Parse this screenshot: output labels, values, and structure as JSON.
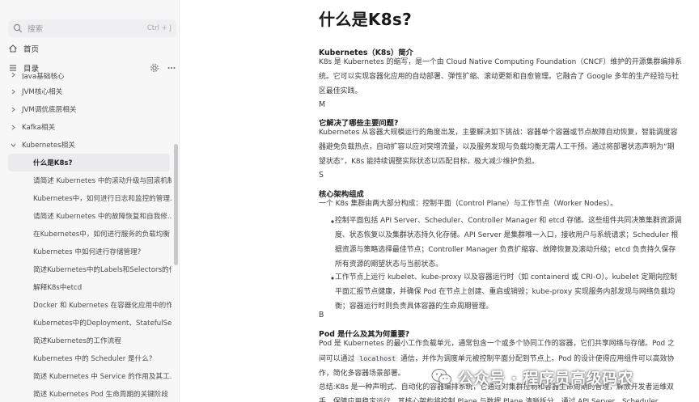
{
  "sidebar": {
    "search": {
      "placeholder": "搜索",
      "shortcut": "Ctrl + J",
      "icon": "search-icon"
    },
    "home": {
      "label": "首页",
      "icon": "home-icon"
    },
    "toc": {
      "label": "目录",
      "icon": "toc-icon",
      "tools": [
        "gear-icon",
        "more-icon"
      ]
    },
    "tree": [
      {
        "label": "Java基础核心",
        "level": 0,
        "expanded": false,
        "cut": true
      },
      {
        "label": "JVM核心相关",
        "level": 0,
        "expanded": false
      },
      {
        "label": "JVM调优底层相关",
        "level": 0,
        "expanded": false
      },
      {
        "label": "Kafka相关",
        "level": 0,
        "expanded": false
      },
      {
        "label": "Kubernetes相关",
        "level": 0,
        "expanded": true
      },
      {
        "label": "什么是K8s?",
        "level": 1,
        "active": true
      },
      {
        "label": "请简述 Kubernetes 中的滚动升级与回滚机制",
        "level": 1
      },
      {
        "label": "Kubernetes中，如何进行日志和监控的管理...",
        "level": 1
      },
      {
        "label": "请简述 Kubernetes 中的故障恢复和自我修...",
        "level": 1
      },
      {
        "label": "在Kubernetes中，如何进行服务的负载均衡",
        "level": 1
      },
      {
        "label": "Kubernetes 中如何进行存储管理?",
        "level": 1
      },
      {
        "label": "简述Kubernetes中的Labels和Selectors的作用",
        "level": 1
      },
      {
        "label": "解释K8s中etcd",
        "level": 1
      },
      {
        "label": "Docker 和 Kubernetes 在容器化应用中的作...",
        "level": 1
      },
      {
        "label": "Kubernetes中的Deployment、StatefulSet...",
        "level": 1
      },
      {
        "label": "简述Kubernetes的工作流程",
        "level": 1
      },
      {
        "label": "Kubernetes 中的 Scheduler 是什么?",
        "level": 1
      },
      {
        "label": "简述 Kubernetes 中 Service 的作用及其工...",
        "level": 1
      },
      {
        "label": "简述 Kubernetes Pod 生命周期的关键阶段",
        "level": 1
      }
    ]
  },
  "article": {
    "title": "什么是K8s?",
    "s1": {
      "heading": "Kubernetes（K8s）简介",
      "lines": [
        "K8s 是 Kubernetes 的缩写，是一个由 Cloud Native Computing Foundation（CNCF）维护的开源集群编排系",
        "统。它可以实现容器化应用的自动部署、弹性扩缩、滚动更新和自愈管理。它融合了 Google 多年的生产经验与社",
        "区最佳实践。"
      ],
      "marker": "M"
    },
    "s2": {
      "heading": "它解决了哪些主要问题?",
      "lines": [
        "Kubernetes 从容器大规模运行的角度出发，主要解决如下挑战：容器单个容器或节点故障自动恢复，智能调度容",
        "器避免负载热点，自动扩容以应对突增流量，以及服务发现与负载均衡无需人工干预。通过将部署状态声明为“期",
        "望状态”，K8s 能持续调整实际状态以匹配目标，极大减少维护负担。"
      ],
      "marker": "S"
    },
    "s3": {
      "heading": "核心架构组成",
      "intro": "一个 K8s 集群由两大部分构成：控制平面（Control Plane）与工作节点（Worker Nodes）。",
      "bullets": [
        [
          "控制平面包括 API Server、Scheduler、Controller Manager 和 etcd 存储。这些组件共同决策集群资源调",
          "度、状态恢复以及集群状态持久化存储。API Server 是集群唯一入口，接收用户与系统请求；Scheduler 根",
          "据资源与策略选择最佳节点；Controller Manager 负责扩缩容、故障恢复及滚动升级；etcd 负责持久保存",
          "所有资源的期望状态与当前状态。"
        ],
        [
          "工作节点上运行 kubelet、kube-proxy 以及容器运行时（如 containerd 或 CRI-O）。kubelet 定期向控制",
          "平面汇报节点健康，并确保 Pod 在节点上创建、重启或销毁；kube-proxy 实现服务内部发现与网络负载均",
          "衡；容器运行时则负责具体容器的生命周期管理。"
        ]
      ],
      "marker": "B"
    },
    "s4": {
      "heading": "Pod 是什么及其为何重要?",
      "line1": "Pod 是 Kubernetes 的最小工作负载单元，通常包含一个或多个协同工作的容器，它们共享网络与存储。Pod 之",
      "line2_pre": "间可以通过",
      "line2_code": "localhost",
      "line2_post": "通信，并作为调度单元被控制平面分配到节点上。Pod 的设计使得应用组件可以高效协",
      "line3": "作，简化多容器场景部署。"
    },
    "summary": {
      "line1": "总结:K8s 是一种声明式、自动化的容器编排系统，它通过对集群控制和容器生命周期的管理，解放开发者运维双",
      "line2": "手，保障应用稳定运行。其核心架构将控制 Plane 与数据 Plane 清晰拆分，通过 API Server、Scheduler、"
    }
  },
  "watermark": {
    "text": "公众号 · 程序员高级码农",
    "icon": "wechat-icon"
  }
}
